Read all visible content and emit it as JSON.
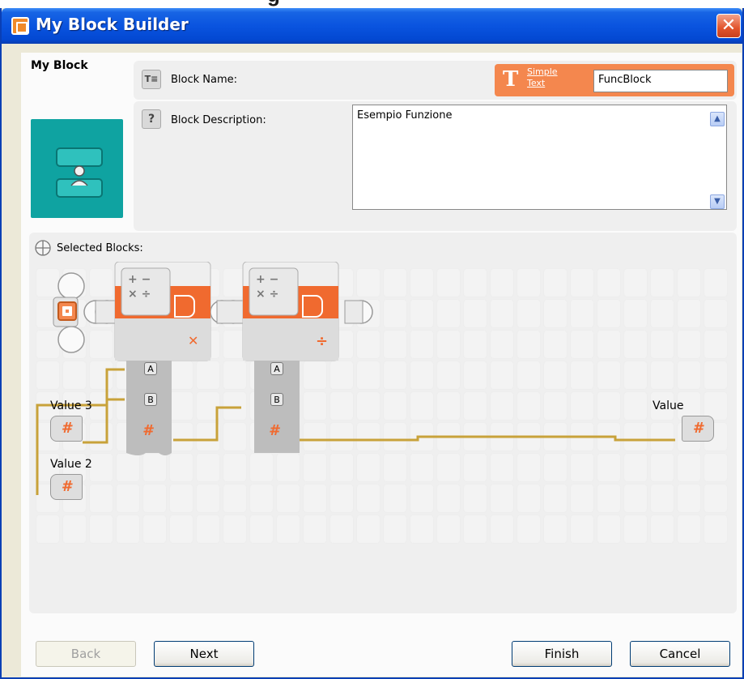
{
  "window": {
    "title": "My Block Builder",
    "close_glyph": "✕"
  },
  "my_block": {
    "title": "My Block"
  },
  "name_field": {
    "label": "Block Name:",
    "icon": "name-tag-icon",
    "simple_text_glyph": "T",
    "simple_text_link_line1": "Simple",
    "simple_text_link_line2": "Text",
    "value": "FuncBlock"
  },
  "description_field": {
    "label": "Block Description:",
    "icon": "question-mark-icon",
    "icon_glyph": "?",
    "value": "Esempio Funzione"
  },
  "selected_blocks": {
    "label": "Selected Blocks:",
    "math_blocks": [
      {
        "operator_glyph": "✕",
        "ports": [
          "A",
          "B",
          "#"
        ]
      },
      {
        "operator_glyph": "÷",
        "ports": [
          "A",
          "B",
          "#"
        ]
      }
    ],
    "math_symbol_top": "+ −",
    "math_symbol_bottom": "× ÷",
    "value_blocks": [
      {
        "label": "Value 3",
        "glyph": "#"
      },
      {
        "label": "Value 2",
        "glyph": "#"
      },
      {
        "label": "Value",
        "glyph": "#"
      }
    ]
  },
  "buttons": {
    "back": "Back",
    "next": "Next",
    "finish": "Finish",
    "cancel": "Cancel"
  },
  "colors": {
    "title_bar": "#0a54df",
    "accent_orange": "#f4874e",
    "teal": "#0fa3a1",
    "wire": "#c8a23a"
  }
}
